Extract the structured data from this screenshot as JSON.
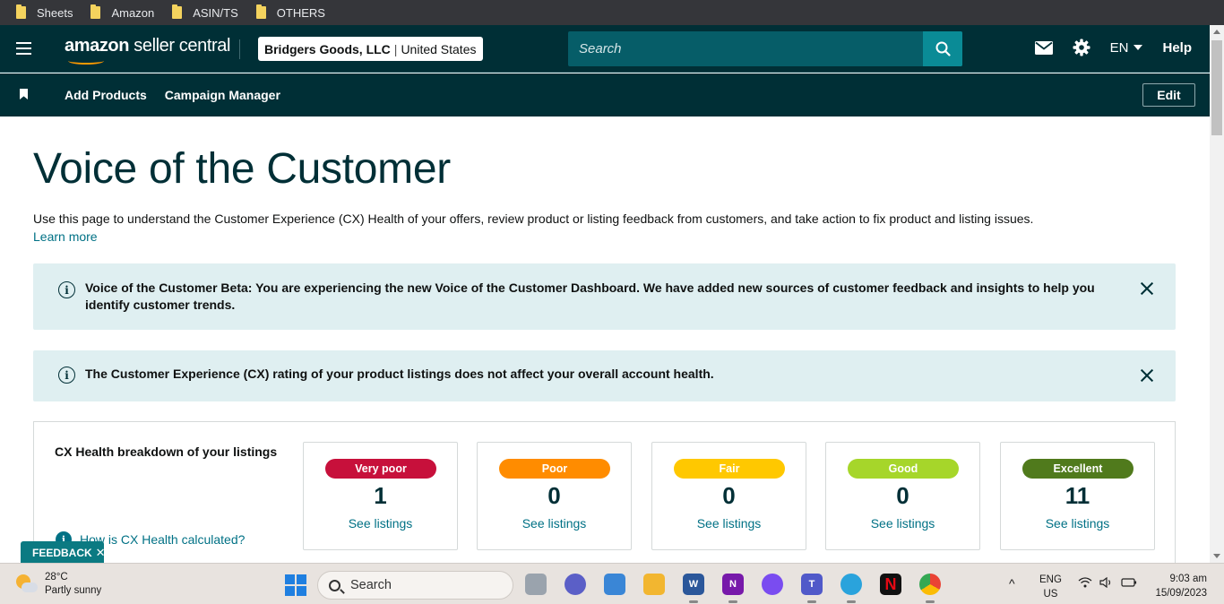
{
  "bookmarks": [
    "Sheets",
    "Amazon",
    "ASIN/TS",
    "OTHERS"
  ],
  "header": {
    "logo_brand": "amazon",
    "logo_product": "seller central",
    "account_name": "Bridgers Goods, LLC",
    "account_region": "United States",
    "search_placeholder": "Search",
    "language": "EN",
    "help_label": "Help"
  },
  "subnav": {
    "links": [
      "Add Products",
      "Campaign Manager"
    ],
    "edit_label": "Edit"
  },
  "page": {
    "title": "Voice of the Customer",
    "intro": "Use this page to understand the Customer Experience (CX) Health of your offers, review product or listing feedback from customers, and take action to fix product and listing issues.",
    "learn_more": "Learn more"
  },
  "alerts": [
    {
      "message": "Voice of the Customer Beta: You are experiencing the new Voice of the Customer Dashboard. We have added new sources of customer feedback and insights to help you identify customer trends."
    },
    {
      "message": "The Customer Experience (CX) rating of your product listings does not affect your overall account health."
    }
  ],
  "cx_health": {
    "title": "CX Health breakdown of your listings",
    "help_link": "How is CX Health calculated?",
    "tiles": [
      {
        "label": "Very poor",
        "count": "1",
        "link": "See listings",
        "color": "#c7103b",
        "text_color": "#ffffff"
      },
      {
        "label": "Poor",
        "count": "0",
        "link": "See listings",
        "color": "#ff8c00",
        "text_color": "#ffffff"
      },
      {
        "label": "Fair",
        "count": "0",
        "link": "See listings",
        "color": "#ffc800",
        "text_color": "#ffffff"
      },
      {
        "label": "Good",
        "count": "0",
        "link": "See listings",
        "color": "#a6d62a",
        "text_color": "#ffffff"
      },
      {
        "label": "Excellent",
        "count": "11",
        "link": "See listings",
        "color": "#507a1c",
        "text_color": "#ffffff"
      }
    ]
  },
  "feedback_label": "FEEDBACK",
  "taskbar": {
    "weather_temp": "28°C",
    "weather_desc": "Partly sunny",
    "search_label": "Search",
    "lang_line1": "ENG",
    "lang_line2": "US",
    "time": "9:03 am",
    "date": "15/09/2023"
  }
}
